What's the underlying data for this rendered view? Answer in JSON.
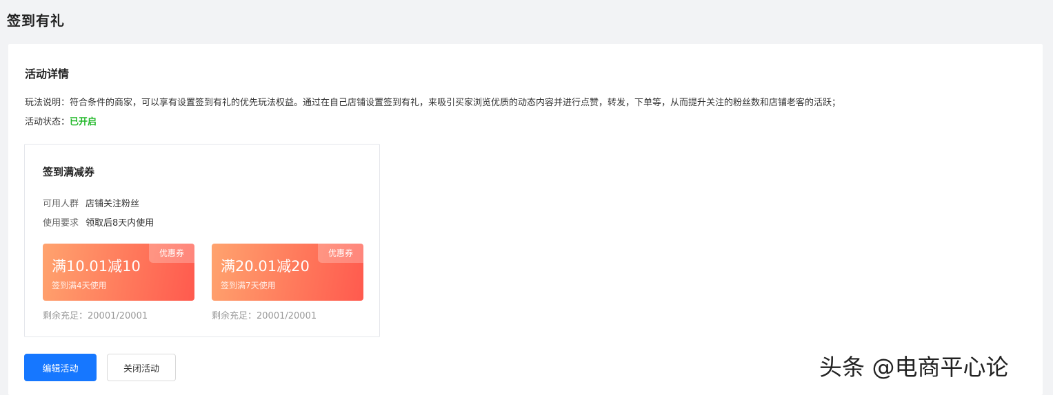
{
  "page": {
    "title": "签到有礼"
  },
  "activity": {
    "section_title": "活动详情",
    "desc_label": "玩法说明：",
    "desc_text": "符合条件的商家，可以享有设置签到有礼的优先玩法权益。通过在自己店铺设置签到有礼，来吸引买家浏览优质的动态内容并进行点赞，转发，下单等，从而提升关注的粉丝数和店铺老客的活跃；",
    "status_label": "活动状态：",
    "status_value": "已开启",
    "status_color": "#21b829"
  },
  "coupon_card": {
    "title": "签到满减券",
    "audience_label": "可用人群",
    "audience_value": "店铺关注粉丝",
    "usage_label": "使用要求",
    "usage_value": "领取后8天内使用",
    "coupons": [
      {
        "badge": "优惠券",
        "amount": "满10.01减10",
        "condition": "签到满4天使用",
        "remaining_label": "剩余充足：",
        "remaining_value": "20001/20001"
      },
      {
        "badge": "优惠券",
        "amount": "满20.01减20",
        "condition": "签到满7天使用",
        "remaining_label": "剩余充足：",
        "remaining_value": "20001/20001"
      }
    ]
  },
  "actions": {
    "edit_label": "编辑活动",
    "close_label": "关闭活动",
    "primary_color": "#1677ff"
  },
  "watermark": {
    "text": "头条 @电商平心论"
  }
}
